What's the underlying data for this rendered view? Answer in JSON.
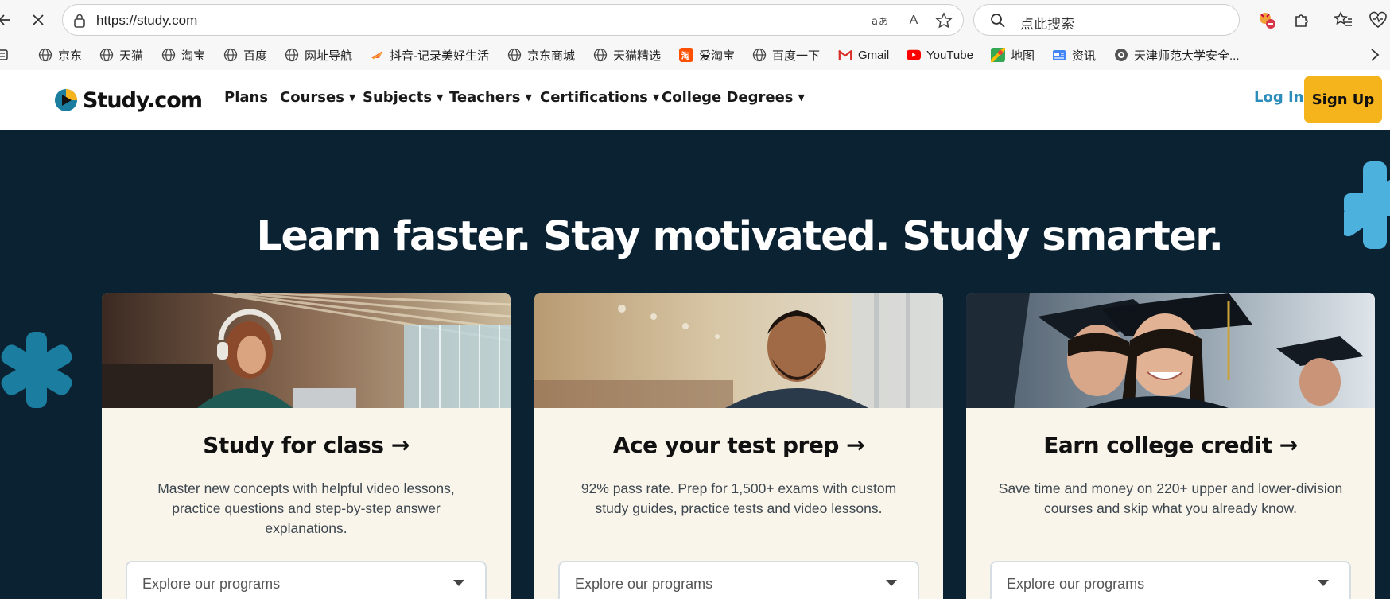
{
  "browser": {
    "url": "https://study.com",
    "search_placeholder": "点此搜索",
    "read_aloud_label": "A"
  },
  "bookmarks": [
    {
      "label": "京东",
      "icon": "globe-icon"
    },
    {
      "label": "天猫",
      "icon": "globe-icon"
    },
    {
      "label": "淘宝",
      "icon": "globe-icon"
    },
    {
      "label": "百度",
      "icon": "globe-icon"
    },
    {
      "label": "网址导航",
      "icon": "globe-icon"
    },
    {
      "label": "抖音-记录美好生活",
      "icon": "douyin-icon"
    },
    {
      "label": "京东商城",
      "icon": "globe-icon"
    },
    {
      "label": "天猫精选",
      "icon": "globe-icon"
    },
    {
      "label": "爱淘宝",
      "icon": "taobao-icon"
    },
    {
      "label": "百度一下",
      "icon": "globe-icon"
    },
    {
      "label": "Gmail",
      "icon": "gmail-icon"
    },
    {
      "label": "YouTube",
      "icon": "youtube-icon"
    },
    {
      "label": "地图",
      "icon": "maps-icon"
    },
    {
      "label": "资讯",
      "icon": "news-icon"
    },
    {
      "label": "天津师范大学安全...",
      "icon": "site-icon"
    }
  ],
  "site": {
    "logo_text": "Study.com",
    "nav": [
      {
        "label": "Plans",
        "dropdown": false
      },
      {
        "label": "Courses",
        "dropdown": true
      },
      {
        "label": "Subjects",
        "dropdown": true
      },
      {
        "label": "Teachers",
        "dropdown": true
      },
      {
        "label": "Certifications",
        "dropdown": true
      },
      {
        "label": "College Degrees",
        "dropdown": true
      }
    ],
    "login_label": "Log In",
    "signup_label": "Sign Up"
  },
  "hero": {
    "headline": "Learn faster. Stay motivated. Study smarter.",
    "cards": [
      {
        "title": "Study for class →",
        "description": "Master new concepts with helpful video lessons, practice questions and step-by-step answer explanations.",
        "select_placeholder": "Explore our programs"
      },
      {
        "title": "Ace your test prep →",
        "description": "92% pass rate. Prep for 1,500+ exams with custom study guides, practice tests and video lessons.",
        "select_placeholder": "Explore our programs"
      },
      {
        "title": "Earn college credit →",
        "description": "Save time and money on 220+ upper and lower-division courses and skip what you already know.",
        "select_placeholder": "Explore our programs"
      }
    ]
  },
  "colors": {
    "hero_bg": "#0b2232",
    "card_bg": "#faf5ea",
    "accent_blue": "#2c8dbb",
    "signup_yellow": "#f5b31c",
    "asterisk_teal": "#1b7ea1",
    "asterisk_light": "#4db1de"
  }
}
